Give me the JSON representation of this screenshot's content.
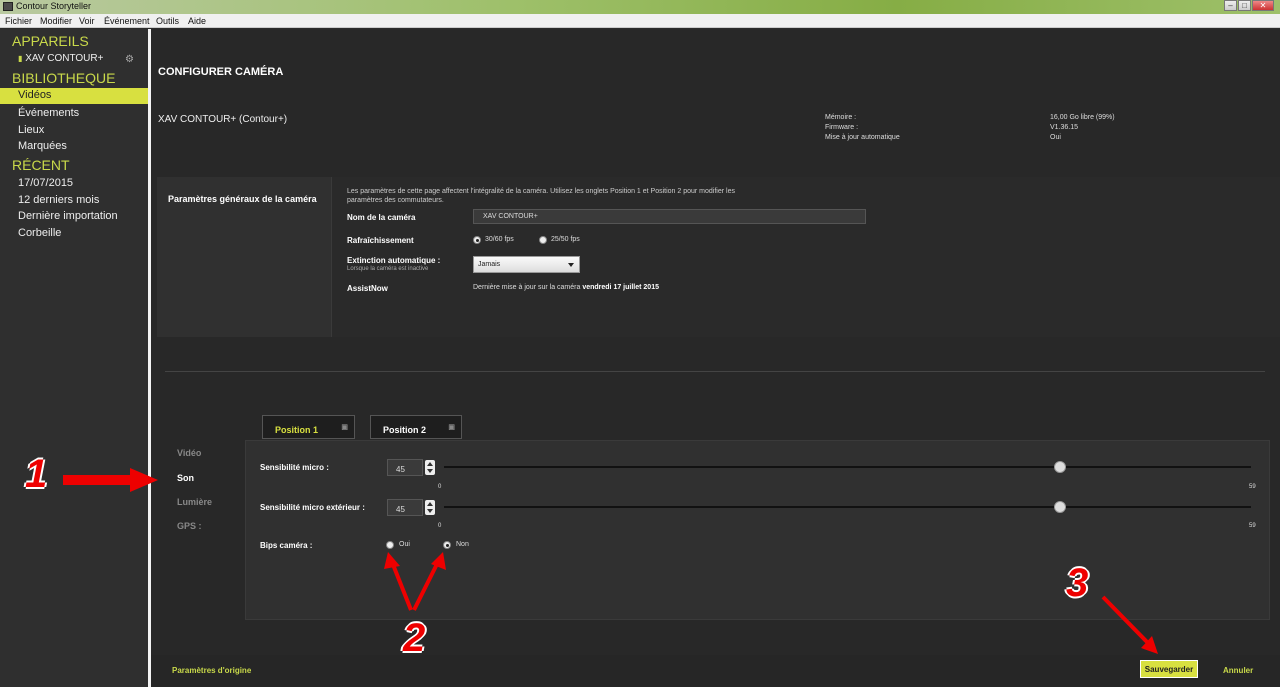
{
  "window": {
    "title": "Contour Storyteller",
    "min": "–",
    "max": "□",
    "close": "✕"
  },
  "menu": [
    "Fichier",
    "Modifier",
    "Voir",
    "Événement",
    "Outils",
    "Aide"
  ],
  "sidebar": {
    "devices_header": "APPAREILS",
    "device": "XAV CONTOUR+",
    "library_header": "BIBLIOTHEQUE",
    "library": [
      "Vidéos",
      "Événements",
      "Lieux",
      "Marquées"
    ],
    "recent_header": "RÉCENT",
    "recent": [
      "17/07/2015",
      "12 derniers mois",
      "Dernière importation",
      "Corbeille"
    ]
  },
  "page": {
    "title": "CONFIGURER CAMÉRA",
    "camera": "XAV CONTOUR+ (Contour+)"
  },
  "info": {
    "memory_label": "Mémoire :",
    "memory_value": "16,00 Go libre (99%)",
    "firmware_label": "Firmware :",
    "firmware_value": "V1.36.15",
    "update_label": "Mise à jour automatique",
    "update_value": "Oui"
  },
  "general": {
    "label": "Paramètres généraux de la caméra",
    "description": "Les paramètres de cette page affectent l'intégralité de la caméra.  Utilisez les onglets Position 1 et Position 2 pour modifier les paramètres des commutateurs.",
    "name_label": "Nom de la caméra",
    "name_value": "XAV CONTOUR+",
    "refresh_label": "Rafraîchissement",
    "refresh_opt1": "30/60 fps",
    "refresh_opt2": "25/50 fps",
    "auto_off_label": "Extinction automatique :",
    "auto_off_sub": "Lorsque la caméra est inactive",
    "auto_off_value": "Jamais",
    "assist_label": "AssistNow",
    "assist_text": "Dernière mise à jour sur la caméra",
    "assist_date": "vendredi 17 juillet 2015"
  },
  "tabs": [
    "Position 1",
    "Position 2"
  ],
  "sections": [
    "Vidéo",
    "Son",
    "Lumière",
    "GPS :"
  ],
  "sound": {
    "mic_label": "Sensibilité micro :",
    "mic_value": "45",
    "ext_label": "Sensibilité micro extérieur :",
    "ext_value": "45",
    "min": "0",
    "max": "59",
    "mic_level": 45,
    "ext_level": 45,
    "bips_label": "Bips caméra :",
    "bips_yes": "Oui",
    "bips_no": "Non"
  },
  "footer": {
    "reset": "Paramètres d'origine",
    "save": "Sauvegarder",
    "cancel": "Annuler"
  },
  "annotations": [
    "1",
    "2",
    "3"
  ],
  "colors": {
    "accent": "#d8e040",
    "annotation": "#e00000"
  }
}
